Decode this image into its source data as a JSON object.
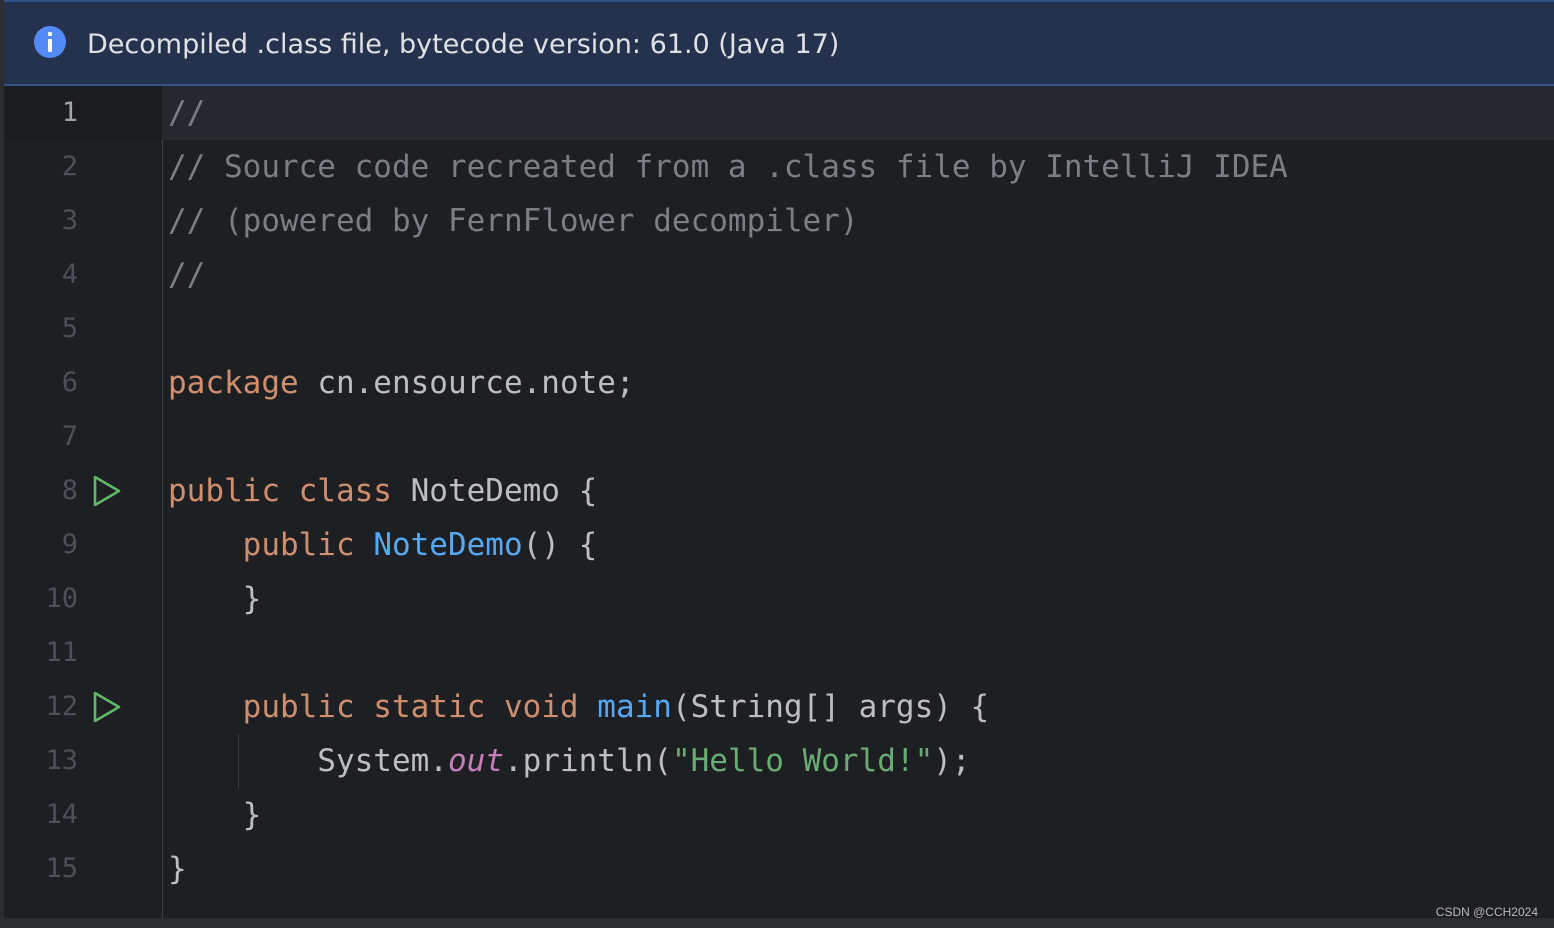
{
  "banner": {
    "icon": "info-icon",
    "text": "Decompiled .class file, bytecode version: 61.0 (Java 17)"
  },
  "editor": {
    "current_line": 1,
    "lines": [
      {
        "number": "1",
        "run_icon": false,
        "tokens": [
          {
            "type": "cm",
            "text": "//"
          }
        ]
      },
      {
        "number": "2",
        "run_icon": false,
        "tokens": [
          {
            "type": "cm",
            "text": "// Source code recreated from a .class file by IntelliJ IDEA"
          }
        ]
      },
      {
        "number": "3",
        "run_icon": false,
        "tokens": [
          {
            "type": "cm",
            "text": "// (powered by FernFlower decompiler)"
          }
        ]
      },
      {
        "number": "4",
        "run_icon": false,
        "tokens": [
          {
            "type": "cm",
            "text": "//"
          }
        ]
      },
      {
        "number": "5",
        "run_icon": false,
        "tokens": []
      },
      {
        "number": "6",
        "run_icon": false,
        "tokens": [
          {
            "type": "kw",
            "text": "package"
          },
          {
            "type": "pl",
            "text": " cn.ensource.note;"
          }
        ]
      },
      {
        "number": "7",
        "run_icon": false,
        "tokens": []
      },
      {
        "number": "8",
        "run_icon": true,
        "tokens": [
          {
            "type": "kw",
            "text": "public class"
          },
          {
            "type": "pl",
            "text": " NoteDemo {"
          }
        ]
      },
      {
        "number": "9",
        "run_icon": false,
        "tokens": [
          {
            "type": "pl",
            "text": "    "
          },
          {
            "type": "kw",
            "text": "public"
          },
          {
            "type": "pl",
            "text": " "
          },
          {
            "type": "fn",
            "text": "NoteDemo"
          },
          {
            "type": "pl",
            "text": "() {"
          }
        ]
      },
      {
        "number": "10",
        "run_icon": false,
        "tokens": [
          {
            "type": "pl",
            "text": "    }"
          }
        ]
      },
      {
        "number": "11",
        "run_icon": false,
        "tokens": []
      },
      {
        "number": "12",
        "run_icon": true,
        "tokens": [
          {
            "type": "pl",
            "text": "    "
          },
          {
            "type": "kw",
            "text": "public static void"
          },
          {
            "type": "pl",
            "text": " "
          },
          {
            "type": "fn",
            "text": "main"
          },
          {
            "type": "pl",
            "text": "(String[] args) {"
          }
        ]
      },
      {
        "number": "13",
        "run_icon": false,
        "tokens": [
          {
            "type": "pl",
            "text": "        System."
          },
          {
            "type": "fld",
            "text": "out"
          },
          {
            "type": "pl",
            "text": ".println("
          },
          {
            "type": "st",
            "text": "\"Hello World!\""
          },
          {
            "type": "pl",
            "text": ");"
          }
        ]
      },
      {
        "number": "14",
        "run_icon": false,
        "tokens": [
          {
            "type": "pl",
            "text": "    }"
          }
        ]
      },
      {
        "number": "15",
        "run_icon": false,
        "tokens": [
          {
            "type": "pl",
            "text": "}"
          }
        ]
      }
    ]
  },
  "watermark": "CSDN @CCH2024",
  "colors": {
    "background": "#1e1f22",
    "banner": "#25324d",
    "keyword": "#cf8e6d",
    "comment": "#7a7e85",
    "function": "#56a8f5",
    "string": "#6aab73",
    "static_field": "#c77dbb",
    "run_icon": "#5fb865"
  }
}
